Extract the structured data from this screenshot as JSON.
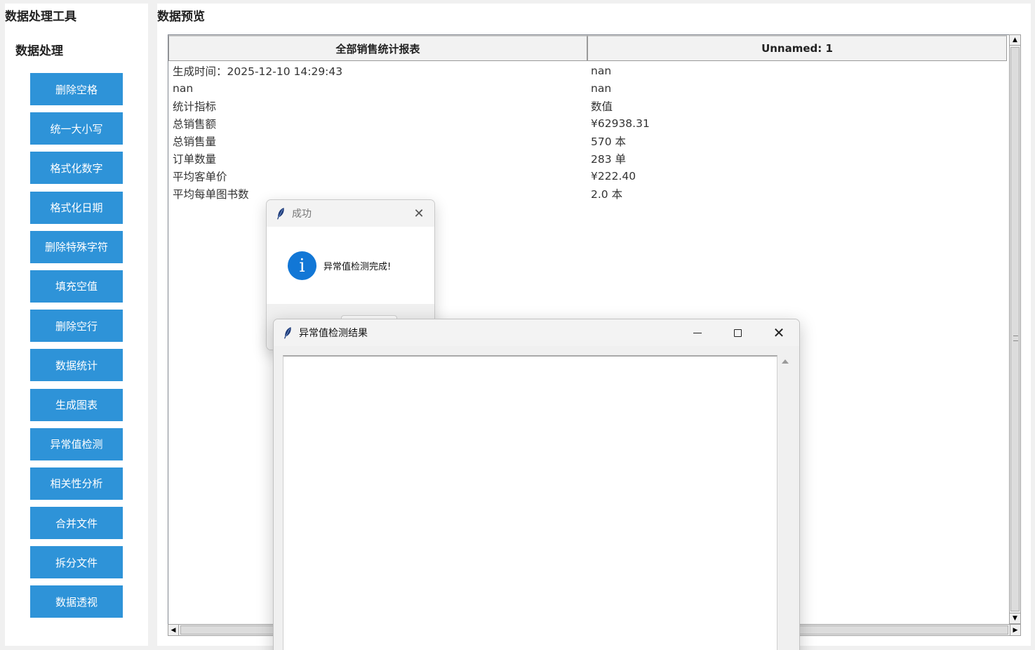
{
  "app": {
    "title": "数据处理工具",
    "section_title": "数据处理",
    "accent_color": "#2e93d8"
  },
  "sidebar": {
    "buttons": [
      {
        "label": "删除空格"
      },
      {
        "label": "统一大小写"
      },
      {
        "label": "格式化数字"
      },
      {
        "label": "格式化日期"
      },
      {
        "label": "删除特殊字符"
      },
      {
        "label": "填充空值"
      },
      {
        "label": "删除空行"
      },
      {
        "label": "数据统计"
      },
      {
        "label": "生成图表"
      },
      {
        "label": "异常值检测"
      },
      {
        "label": "相关性分析"
      },
      {
        "label": "合并文件"
      },
      {
        "label": "拆分文件"
      },
      {
        "label": "数据透视"
      }
    ]
  },
  "preview": {
    "title": "数据预览",
    "columns": [
      "全部销售统计报表",
      "Unnamed: 1"
    ],
    "rows": [
      [
        "生成时间：2025-12-10 14:29:43",
        "nan"
      ],
      [
        "nan",
        "nan"
      ],
      [
        "统计指标",
        "数值"
      ],
      [
        "总销售额",
        "¥62938.31"
      ],
      [
        "总销售量",
        "570 本"
      ],
      [
        "订单数量",
        "283 单"
      ],
      [
        "平均客单价",
        "¥222.40"
      ],
      [
        "平均每单图书数",
        "2.0 本"
      ]
    ]
  },
  "success_dialog": {
    "title": "成功",
    "message": "异常值检测完成!",
    "icon": "info-icon",
    "close_icon": "close-icon"
  },
  "results_window": {
    "title": "异常值检测结果",
    "minimize_icon": "minimize-icon",
    "maximize_icon": "maximize-icon",
    "close_icon": "close-icon",
    "content": ""
  }
}
